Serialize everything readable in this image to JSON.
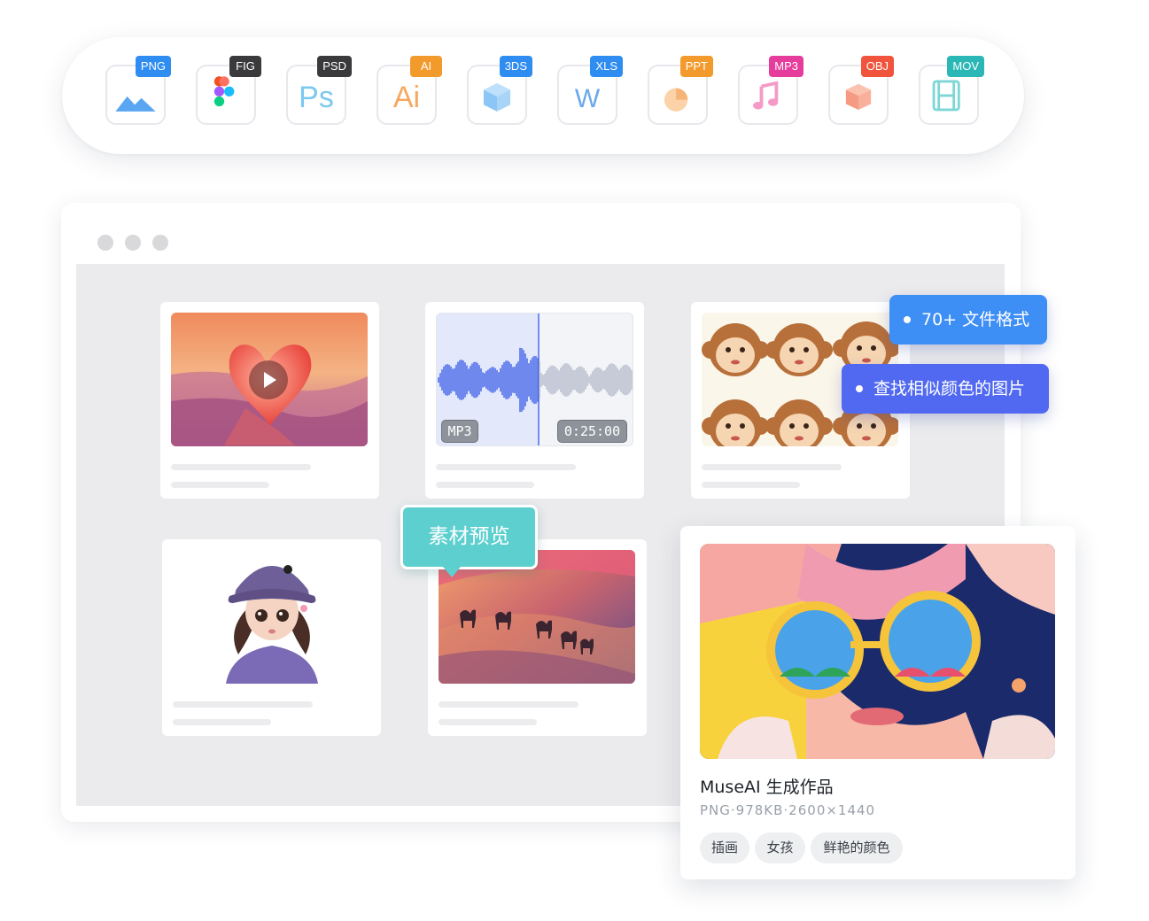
{
  "formats": [
    {
      "label": "PNG",
      "color": "#2f8cf0",
      "icon": "image-icon"
    },
    {
      "label": "FIG",
      "color": "#3a3a3c",
      "icon": "figma-icon"
    },
    {
      "label": "PSD",
      "color": "#3a3a3c",
      "icon": "photoshop-icon"
    },
    {
      "label": "AI",
      "color": "#f39a2c",
      "icon": "illustrator-icon"
    },
    {
      "label": "3DS",
      "color": "#2f8cf0",
      "icon": "cube-icon"
    },
    {
      "label": "XLS",
      "color": "#2f8cf0",
      "icon": "word-icon"
    },
    {
      "label": "PPT",
      "color": "#f39a2c",
      "icon": "pie-icon"
    },
    {
      "label": "MP3",
      "color": "#e63c9c",
      "icon": "music-icon"
    },
    {
      "label": "OBJ",
      "color": "#f0543c",
      "icon": "box-icon"
    },
    {
      "label": "MOV",
      "color": "#2cb7b7",
      "icon": "film-icon"
    }
  ],
  "glyphs": {
    "ps": "Ps",
    "ai": "Ai",
    "w": "W"
  },
  "audio": {
    "format": "MP3",
    "duration": "0:25:00"
  },
  "tips": {
    "formats": "70+ 文件格式",
    "similar_color": "查找相似颜色的图片",
    "preview": "素材预览"
  },
  "detail": {
    "title": "MuseAI 生成作品",
    "meta": "PNG·978KB·2600×1440",
    "tags": [
      "插画",
      "女孩",
      "鲜艳的颜色"
    ]
  },
  "colors": {
    "tip_blue": "#3d8ef5",
    "tip_indigo": "#5169f0",
    "preview_teal": "#5ecfcf"
  }
}
